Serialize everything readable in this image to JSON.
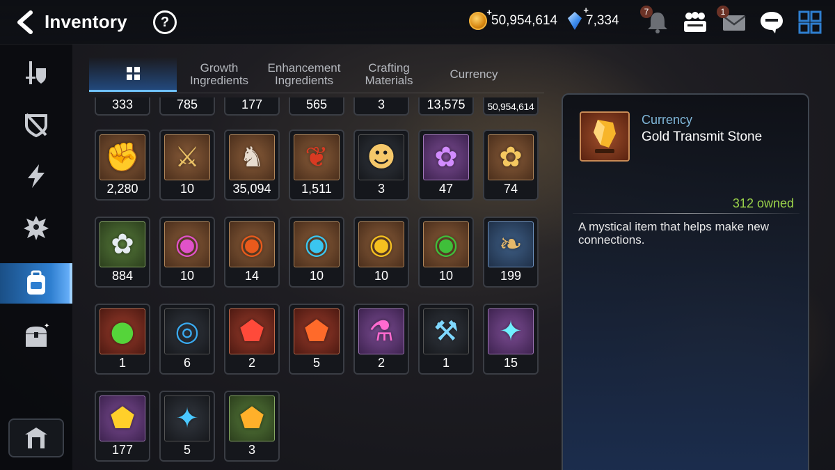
{
  "header": {
    "title": "Inventory",
    "help_label": "?",
    "gold_amount": "50,954,614",
    "crystal_amount": "7,334",
    "plus": "+",
    "notification_badge": "7",
    "mail_badge": "1"
  },
  "tabs": [
    {
      "label": ""
    },
    {
      "label": "Growth Ingredients"
    },
    {
      "label": "Enhancement Ingredients"
    },
    {
      "label": "Crafting Materials"
    },
    {
      "label": "Currency"
    }
  ],
  "items_partial_row": [
    "333",
    "785",
    "177",
    "565",
    "3",
    "13,575",
    "50,954,614"
  ],
  "items": [
    {
      "name": "fist-emblem-icon",
      "count": "2,280",
      "frame": "brown",
      "glyph": "✊",
      "color": "#f0b04a"
    },
    {
      "name": "banner-icon",
      "count": "10",
      "frame": "brown",
      "glyph": "⚔",
      "color": "#e9c065"
    },
    {
      "name": "knight-piece-icon",
      "count": "35,094",
      "frame": "brown",
      "glyph": "♞",
      "color": "#e8ddd0"
    },
    {
      "name": "red-leaf-icon",
      "count": "1,511",
      "frame": "brown",
      "glyph": "❦",
      "color": "#d83a22"
    },
    {
      "name": "cat-portrait-icon",
      "count": "3",
      "frame": "dark",
      "glyph": "☻",
      "color": "#f5c86a"
    },
    {
      "name": "purple-flower-icon",
      "count": "47",
      "frame": "purple",
      "glyph": "✿",
      "color": "#d28cff"
    },
    {
      "name": "gold-flower-icon",
      "count": "74",
      "frame": "brown",
      "glyph": "✿",
      "color": "#f5c860"
    },
    {
      "name": "silver-flower-icon",
      "count": "884",
      "frame": "green",
      "glyph": "✿",
      "color": "#e6ecf2"
    },
    {
      "name": "pink-rune-icon",
      "count": "10",
      "frame": "brown",
      "glyph": "◉",
      "color": "#e052c8"
    },
    {
      "name": "red-rune-icon",
      "count": "14",
      "frame": "brown",
      "glyph": "◉",
      "color": "#e85a1c"
    },
    {
      "name": "blue-rune-icon",
      "count": "10",
      "frame": "brown",
      "glyph": "◉",
      "color": "#3ac6f0"
    },
    {
      "name": "yellow-rune-icon",
      "count": "10",
      "frame": "brown",
      "glyph": "◉",
      "color": "#f5c020"
    },
    {
      "name": "green-rune-icon",
      "count": "10",
      "frame": "brown",
      "glyph": "◉",
      "color": "#3fbf3a"
    },
    {
      "name": "fish-icon",
      "count": "199",
      "frame": "blue",
      "glyph": "❧",
      "color": "#e6b96a"
    },
    {
      "name": "green-orb-icon",
      "count": "1",
      "frame": "red",
      "glyph": "●",
      "color": "#55d43a"
    },
    {
      "name": "blue-sigil-icon",
      "count": "6",
      "frame": "dark",
      "glyph": "◎",
      "color": "#3aaaf0"
    },
    {
      "name": "red-gem-icon",
      "count": "2",
      "frame": "red",
      "glyph": "⬟",
      "color": "#ff4a3a"
    },
    {
      "name": "hammer-stone-icon",
      "count": "5",
      "frame": "red",
      "glyph": "⬟",
      "color": "#ff6a2a"
    },
    {
      "name": "potion-icon",
      "count": "2",
      "frame": "purple",
      "glyph": "⚗",
      "color": "#ff6ad0"
    },
    {
      "name": "hammer-rune-icon",
      "count": "1",
      "frame": "dark",
      "glyph": "⚒",
      "color": "#7fd8ff"
    },
    {
      "name": "cross-stone-icon",
      "count": "15",
      "frame": "purple",
      "glyph": "✦",
      "color": "#6ff0ff"
    },
    {
      "name": "yellow-stone-icon",
      "count": "177",
      "frame": "purple",
      "glyph": "⬟",
      "color": "#ffd02a"
    },
    {
      "name": "star-stone-icon",
      "count": "5",
      "frame": "dark",
      "glyph": "✦",
      "color": "#4ac8ff"
    },
    {
      "name": "orange-stone-icon",
      "count": "3",
      "frame": "green",
      "glyph": "⬟",
      "color": "#ffb02a"
    }
  ],
  "detail": {
    "category": "Currency",
    "name": "Gold Transmit Stone",
    "owned": "312 owned",
    "description": "A mystical item that helps make new connections."
  },
  "colors": {
    "accent_blue": "#2f7fd0",
    "owned_green": "#9bd34a",
    "category_blue": "#7fb6d8"
  }
}
